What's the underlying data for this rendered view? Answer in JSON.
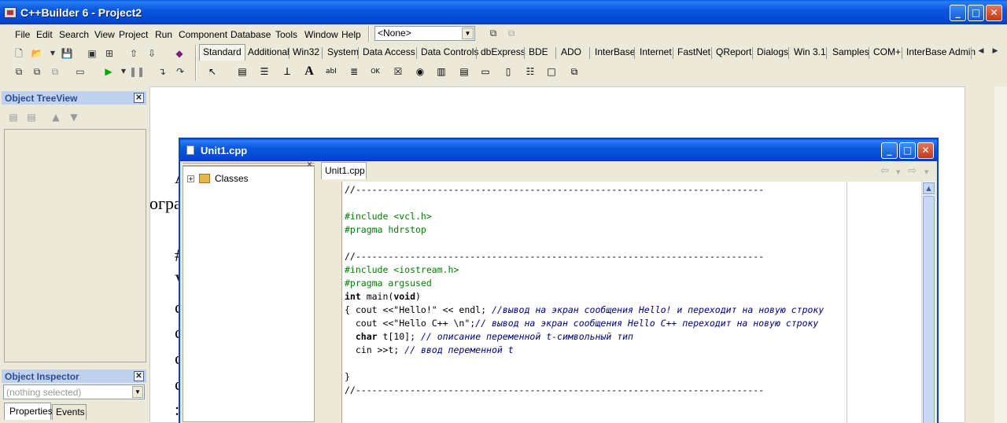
{
  "window": {
    "title": "C++Builder 6 - Project2"
  },
  "menu": [
    {
      "label": "File"
    },
    {
      "label": "Edit"
    },
    {
      "label": "Search"
    },
    {
      "label": "View"
    },
    {
      "label": "Project"
    },
    {
      "label": "Run"
    },
    {
      "label": "Component"
    },
    {
      "label": "Database"
    },
    {
      "label": "Tools"
    },
    {
      "label": "Window"
    },
    {
      "label": "Help"
    }
  ],
  "configuration_combo": {
    "value": "<None>"
  },
  "component_palette": {
    "tabs": [
      "Standard",
      "Additional",
      "Win32",
      "System",
      "Data Access",
      "Data Controls",
      "dbExpress",
      "BDE",
      "ADO",
      "InterBase",
      "Internet",
      "FastNet",
      "QReport",
      "Dialogs",
      "Win 3.1",
      "Samples",
      "COM+",
      "InterBase Admin"
    ],
    "active_tab": "Standard"
  },
  "object_treeview": {
    "title": "Object TreeView"
  },
  "object_inspector": {
    "title": "Object Inspector",
    "selection": "(nothing selected)",
    "tabs": [
      "Properties",
      "Events"
    ]
  },
  "editor": {
    "title": "Unit1.cpp",
    "file_tab": "Unit1.cpp",
    "tree_root": "Classes",
    "code_lines": [
      {
        "text": "//---------------------------------------------------------------------------",
        "style": "normal"
      },
      {
        "text": "",
        "style": "normal"
      },
      {
        "text": "#include <vcl.h>",
        "style": "green"
      },
      {
        "text": "#pragma hdrstop",
        "style": "green"
      },
      {
        "text": "",
        "style": "normal"
      },
      {
        "text": "//---------------------------------------------------------------------------",
        "style": "normal"
      },
      {
        "text": "#include <iostream.h>",
        "style": "green"
      },
      {
        "text": "#pragma argsused",
        "style": "green"
      },
      {
        "text": "int main(void)",
        "style": "normal"
      },
      {
        "text": "{ cout <<\"Hello!\" << endl; //вывод на экран сообщения Hello! и переходит на новую строку",
        "style": "normal"
      },
      {
        "text": "  cout <<\"Hello C++ \\n\";// вывод на экран сообщения Hello C++ переходит на новую строку",
        "style": "normal"
      },
      {
        "text": "  char t[10]; // описание переменной t-символьный тип",
        "style": "normal"
      },
      {
        "text": "  cin >>t; // ввод переменной t",
        "style": "normal"
      },
      {
        "text": "",
        "style": "normal"
      },
      {
        "text": "}",
        "style": "normal"
      },
      {
        "text": "//---------------------------------------------------------------------------",
        "style": "normal"
      }
    ]
  }
}
